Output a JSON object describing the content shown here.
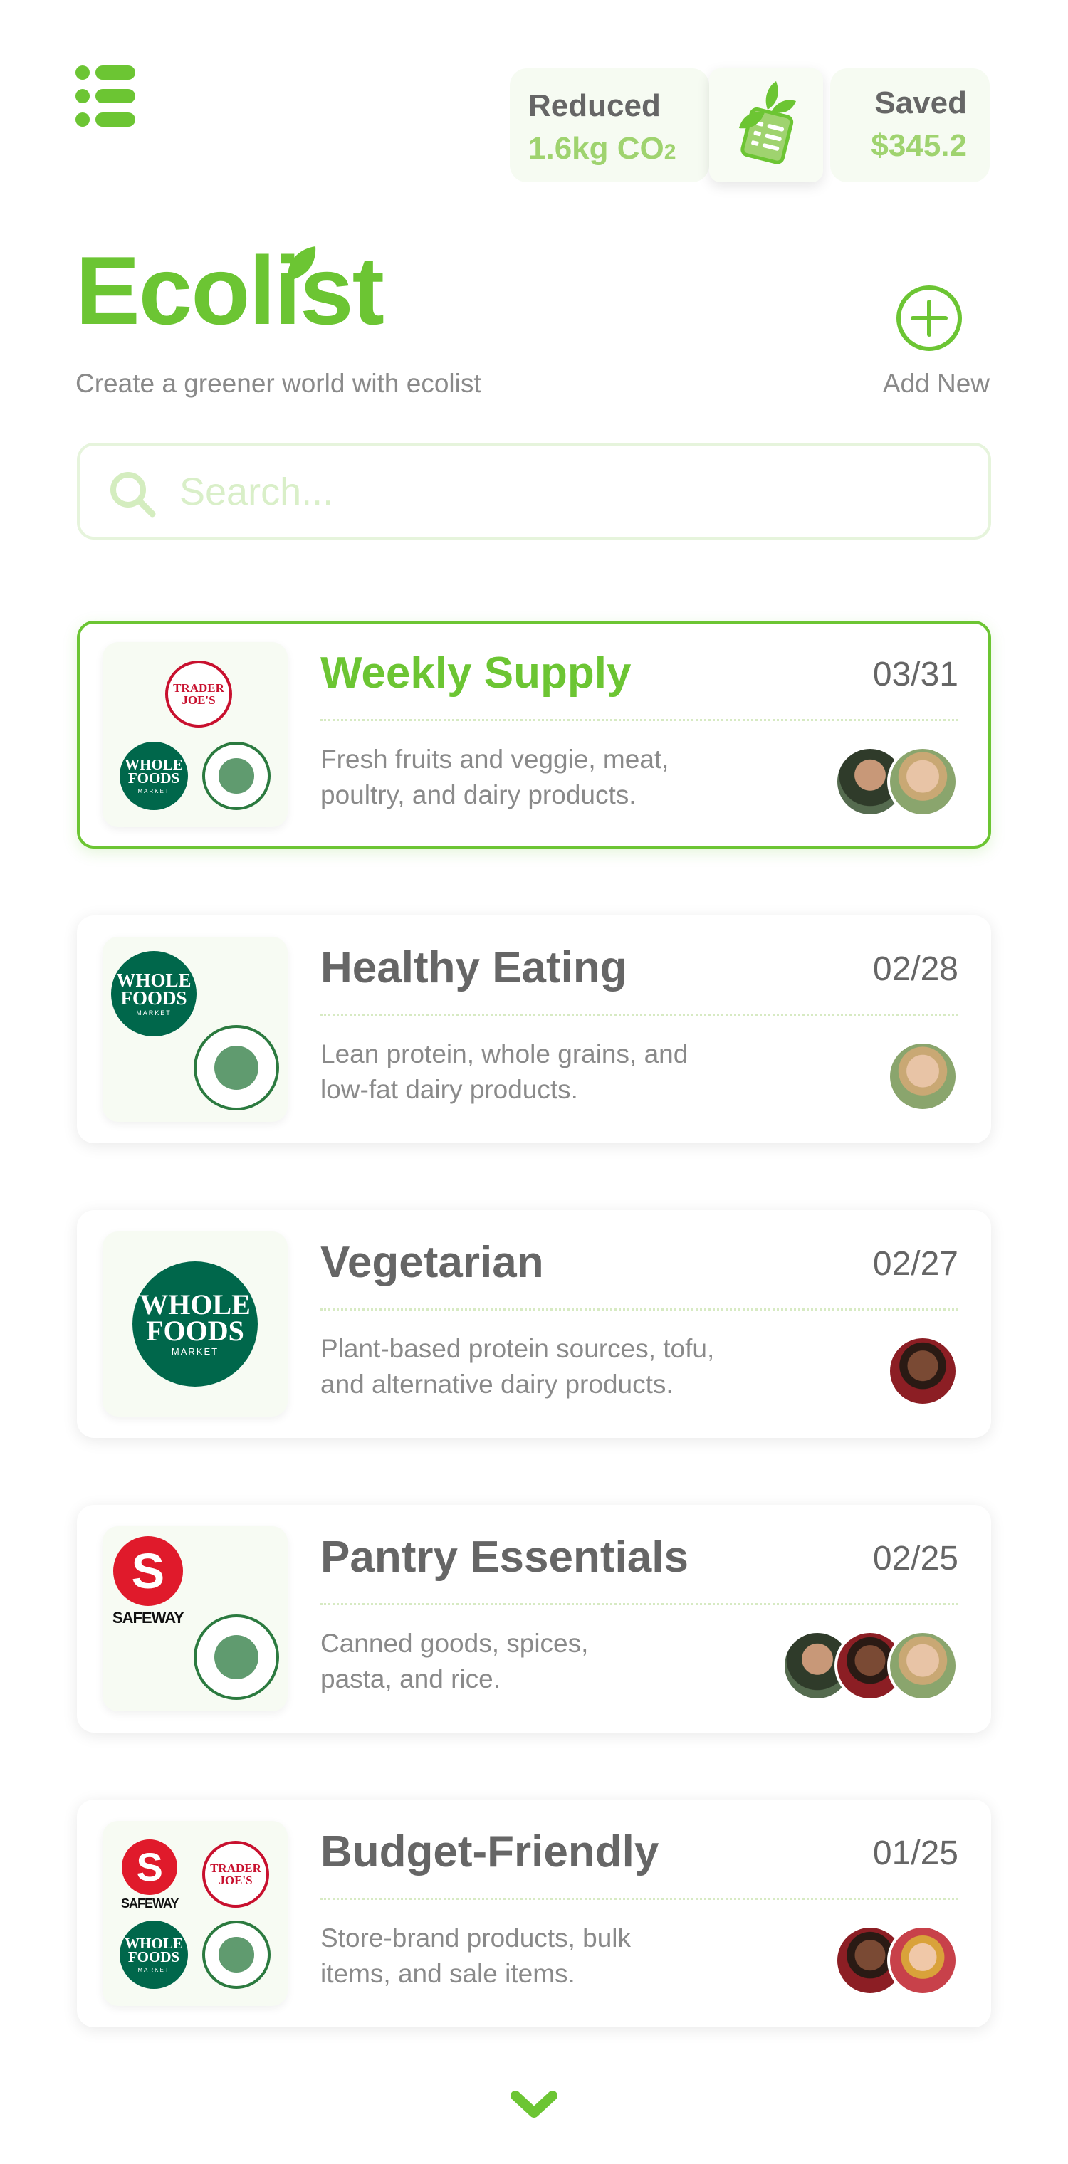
{
  "header": {
    "menu_icon": "menu-list-icon",
    "reduced_label": "Reduced",
    "reduced_value": "1.6kg CO",
    "reduced_sub": "2",
    "saved_label": "Saved",
    "saved_value": "$345.2",
    "center_icon": "eco-list-icon"
  },
  "brand": {
    "logo": "Ecolist",
    "tagline": "Create a greener world with ecolist",
    "add_new_label": "Add New"
  },
  "search": {
    "placeholder": "Search..."
  },
  "colors": {
    "brand_green": "#6cc533",
    "light_green": "#9fd36f",
    "text_gray": "#666666",
    "muted_gray": "#8a8a8a"
  },
  "lists": [
    {
      "title": "Weekly Supply",
      "date": "03/31",
      "desc_line1": "Fresh fruits and veggie, meat,",
      "desc_line2": "poultry, and dairy products.",
      "active": true,
      "stores": [
        "Trader Joe's",
        "Whole Foods Market",
        "Berkeley Bowl"
      ],
      "members": 2
    },
    {
      "title": "Healthy Eating",
      "date": "02/28",
      "desc_line1": "Lean protein, whole grains, and",
      "desc_line2": "low-fat dairy products.",
      "active": false,
      "stores": [
        "Whole Foods Market",
        "Berkeley Bowl"
      ],
      "members": 1
    },
    {
      "title": "Vegetarian",
      "date": "02/27",
      "desc_line1": "Plant-based protein sources, tofu,",
      "desc_line2": "and alternative dairy products.",
      "active": false,
      "stores": [
        "Whole Foods Market"
      ],
      "members": 1
    },
    {
      "title": "Pantry Essentials",
      "date": "02/25",
      "desc_line1": "Canned goods, spices,",
      "desc_line2": "pasta, and rice.",
      "active": false,
      "stores": [
        "Safeway",
        "Berkeley Bowl"
      ],
      "members": 3
    },
    {
      "title": "Budget-Friendly",
      "date": "01/25",
      "desc_line1": "Store-brand products, bulk",
      "desc_line2": "items, and sale items.",
      "active": false,
      "stores": [
        "Safeway",
        "Trader Joe's",
        "Whole Foods Market",
        "Berkeley Bowl"
      ],
      "members": 2
    }
  ],
  "store_logo_text": {
    "wf_line1": "WHOLE",
    "wf_line2": "FOODS",
    "wf_line3": "MARKET",
    "tj_line1": "TRADER",
    "tj_line2": "JOE'S",
    "sw_name": "SAFEWAY"
  },
  "footer": {
    "more_icon": "chevron-down-icon"
  }
}
